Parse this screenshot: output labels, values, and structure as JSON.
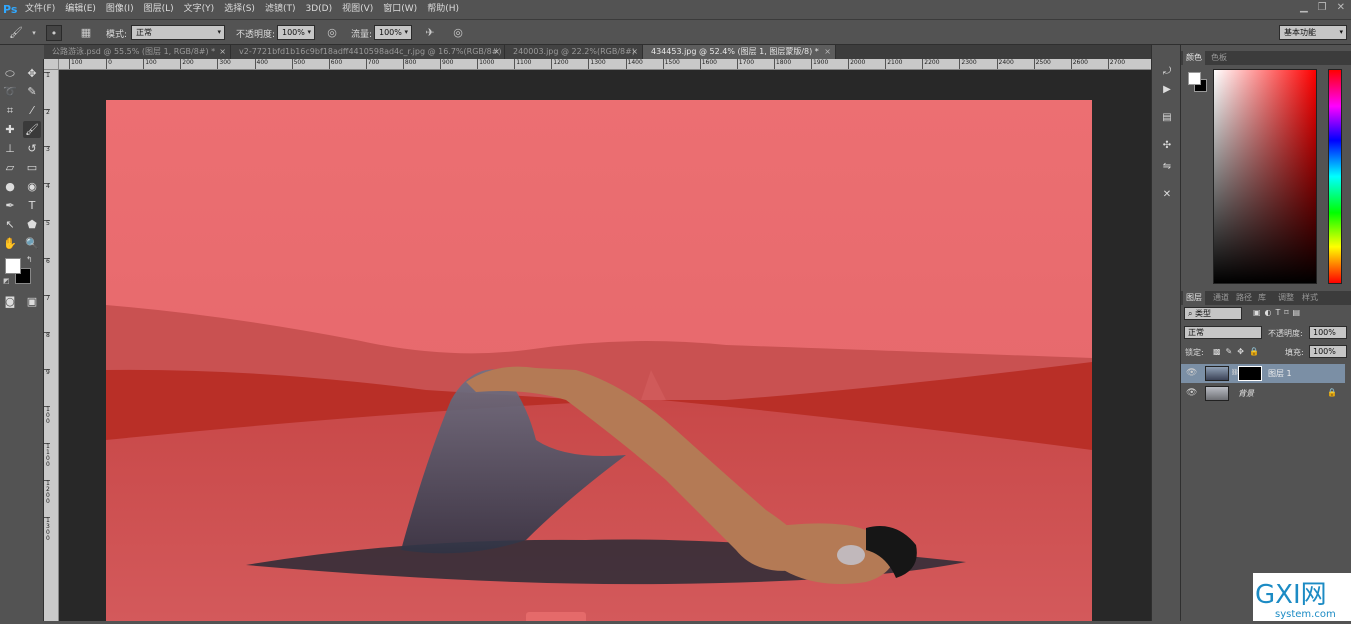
{
  "app": {
    "logo": "Ps"
  },
  "menu": [
    "文件(F)",
    "编辑(E)",
    "图像(I)",
    "图层(L)",
    "文字(Y)",
    "选择(S)",
    "滤镜(T)",
    "3D(D)",
    "视图(V)",
    "窗口(W)",
    "帮助(H)"
  ],
  "options": {
    "mode_label": "模式:",
    "mode_value": "正常",
    "opacity_label": "不透明度:",
    "opacity_value": "100%",
    "flow_label": "流量:",
    "flow_value": "100%",
    "workspace": "基本功能"
  },
  "tabs": [
    {
      "label": "公路游泳.psd @ 55.5% (图层 1, RGB/8#) *"
    },
    {
      "label": "v2-7721bfd1b16c9bf18adff4410598ad4c_r.jpg @ 16.7%(RGB/8#)"
    },
    {
      "label": "240003.jpg @ 22.2%(RGB/8#)"
    },
    {
      "label": "434453.jpg @ 52.4% (图层 1, 图层蒙版/8) *"
    }
  ],
  "hruler_labels": [
    "100",
    "0",
    "100",
    "200",
    "300",
    "400",
    "500",
    "600",
    "700",
    "800",
    "900",
    "1000",
    "1100",
    "1200",
    "1300",
    "1400",
    "1500",
    "1600",
    "1700",
    "1800",
    "1900",
    "2000",
    "2100",
    "2200",
    "2300",
    "2400",
    "2500",
    "2600",
    "2700"
  ],
  "vruler_labels": [
    "1",
    "2",
    "3",
    "4",
    "5",
    "6",
    "7",
    "8",
    "9",
    "100",
    "1100",
    "1200",
    "1300"
  ],
  "color_panel": {
    "tabs": [
      "颜色",
      "色板"
    ]
  },
  "layers_panel": {
    "tabs": [
      "图层",
      "通道",
      "路径",
      "库",
      "调整",
      "样式"
    ],
    "filter": "类型",
    "blend": "正常",
    "opacity_label": "不透明度:",
    "opacity_value": "100%",
    "lock_label": "锁定:",
    "fill_label": "填充:",
    "fill_value": "100%",
    "layers": [
      {
        "name": "图层 1",
        "selected": true
      },
      {
        "name": "背景",
        "selected": false
      }
    ]
  },
  "watermark": {
    "brand": "GXI网",
    "domain": "system.com"
  }
}
